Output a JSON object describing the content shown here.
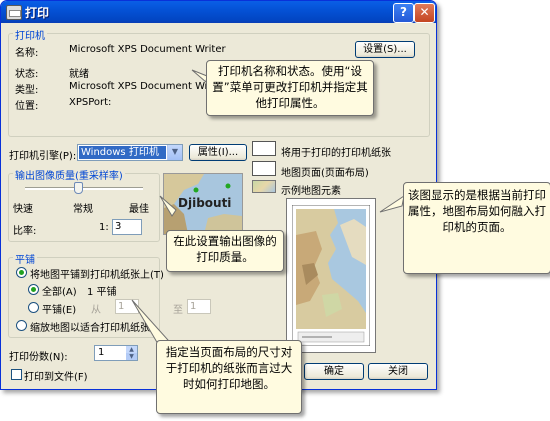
{
  "window": {
    "title": "打印",
    "help": "?",
    "close": "✕"
  },
  "printer": {
    "group_label": "打印机",
    "name_label": "名称:",
    "name_value": "Microsoft XPS Document Writer",
    "status_label": "状态:",
    "status_value": "就绪",
    "type_label": "类型:",
    "type_value": "Microsoft XPS Document Writer",
    "location_label": "位置:",
    "location_value": "XPSPort:",
    "settings_button": "设置(S)..."
  },
  "engine": {
    "label": "打印机引擎(P):",
    "value": "Windows 打印机",
    "properties_button": "属性(I)..."
  },
  "quality": {
    "group_label": "输出图像质量(重采样率)",
    "fast": "快速",
    "normal": "常规",
    "best": "最佳",
    "ratio_label": "比率:",
    "ratio_left": "1:",
    "ratio_value": "3",
    "slider_value": 0.45
  },
  "tiling": {
    "group_label": "平铺",
    "option_tile": "将地图平铺到打印机纸张上(T)",
    "option_all": "全部(A)",
    "all_value": "1 平铺",
    "option_pages": "平铺(E)",
    "from_label": "从",
    "from_value": "1",
    "to_label": "至",
    "to_value": "1",
    "option_scale": "缩放地图以适合打印机纸张:"
  },
  "copies": {
    "label": "打印份数(N):",
    "value": "1"
  },
  "print_to_file": "打印到文件(F)",
  "legend": {
    "paper": "将用于打印的打印机纸张",
    "page": "地图页面(页面布局)",
    "sample": "示例地图元素"
  },
  "map_label": "Djibouti",
  "buttons": {
    "ok": "确定",
    "close": "关闭"
  },
  "callouts": {
    "printer_info": "打印机名称和状态。使用“设置”菜单可更改打印机并指定其他打印属性。",
    "quality": "在此设置输出图像的打印质量。",
    "preview": "该图显示的是根据当前打印属性，地图布局如何融入打印机的页面。",
    "tiling": "指定当页面布局的尺寸对于打印机的纸张而言过大时如何打印地图。"
  },
  "colors": {
    "title_bar": "#0452d6",
    "group_label": "#0046d5",
    "callout_bg": "#fffbe0"
  }
}
